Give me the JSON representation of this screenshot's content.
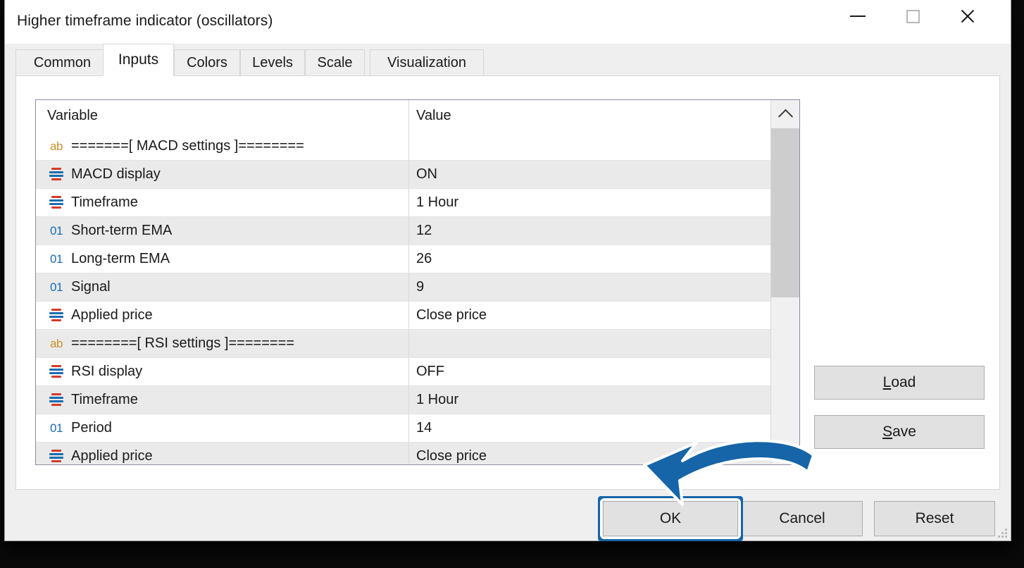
{
  "window": {
    "title": "Higher timeframe indicator (oscillators)",
    "controls": {
      "minimize": "minimize-icon",
      "maximize": "maximize-icon",
      "close": "close-icon"
    }
  },
  "tabs": [
    {
      "label": "Common",
      "active": false
    },
    {
      "label": "Inputs",
      "active": true
    },
    {
      "label": "Colors",
      "active": false
    },
    {
      "label": "Levels",
      "active": false
    },
    {
      "label": "Scale",
      "active": false
    },
    {
      "label": "Visualization",
      "active": false
    }
  ],
  "grid": {
    "columns": [
      "Variable",
      "Value"
    ],
    "rows": [
      {
        "icon": "ab",
        "variable": "=======[ MACD settings ]========",
        "value": "",
        "separator": true
      },
      {
        "icon": "enum",
        "variable": "MACD display",
        "value": "ON"
      },
      {
        "icon": "enum",
        "variable": "Timeframe",
        "value": "1 Hour"
      },
      {
        "icon": "01",
        "variable": "Short-term EMA",
        "value": "12"
      },
      {
        "icon": "01",
        "variable": "Long-term EMA",
        "value": "26"
      },
      {
        "icon": "01",
        "variable": "Signal",
        "value": "9"
      },
      {
        "icon": "enum",
        "variable": "Applied price",
        "value": "Close price"
      },
      {
        "icon": "ab",
        "variable": "========[ RSI settings ]========",
        "value": "",
        "separator": true
      },
      {
        "icon": "enum",
        "variable": "RSI display",
        "value": "OFF"
      },
      {
        "icon": "enum",
        "variable": "Timeframe",
        "value": "1 Hour"
      },
      {
        "icon": "01",
        "variable": "Period",
        "value": "14"
      },
      {
        "icon": "enum",
        "variable": "Applied price",
        "value": "Close price"
      }
    ],
    "scrollbar": {
      "up_arrow": "chevron-up-icon",
      "down_arrow": "chevron-down-icon"
    }
  },
  "side_buttons": {
    "load": {
      "accel": "L",
      "rest": "oad"
    },
    "save": {
      "accel": "S",
      "rest": "ave"
    }
  },
  "bottom_buttons": {
    "ok": "OK",
    "cancel": "Cancel",
    "reset": "Reset"
  },
  "annotation": {
    "highlight_target": "ok-button",
    "arrow": "curved-arrow-to-ok-button",
    "color": "#1565a8"
  }
}
